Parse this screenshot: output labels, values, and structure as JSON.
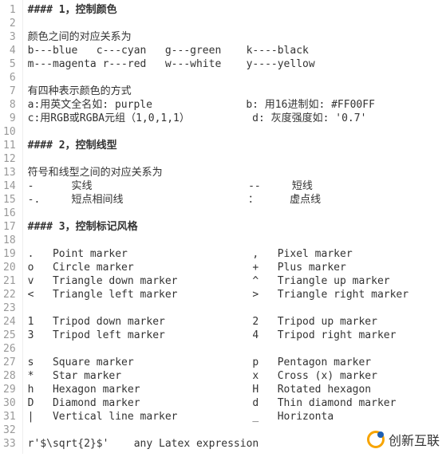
{
  "lines": [
    {
      "n": 1,
      "t": "#### 1，控制颜色",
      "c": "heading"
    },
    {
      "n": 2,
      "t": " "
    },
    {
      "n": 3,
      "t": "颜色之间的对应关系为"
    },
    {
      "n": 4,
      "t": "b---blue   c---cyan   g---green    k----black"
    },
    {
      "n": 5,
      "t": "m---magenta r---red   w---white    y----yellow"
    },
    {
      "n": 6,
      "t": " "
    },
    {
      "n": 7,
      "t": "有四种表示颜色的方式"
    },
    {
      "n": 8,
      "t": "a:用英文全名如: purple               b: 用16进制如: #FF00FF"
    },
    {
      "n": 9,
      "t": "c:用RGB或RGBA元组（1,0,1,1）          d: 灰度强度如: '0.7'"
    },
    {
      "n": 10,
      "t": " "
    },
    {
      "n": 11,
      "t": "#### 2，控制线型",
      "c": "heading"
    },
    {
      "n": 12,
      "t": " "
    },
    {
      "n": 13,
      "t": "符号和线型之间的对应关系为"
    },
    {
      "n": 14,
      "t": "-      实线                         --     短线"
    },
    {
      "n": 15,
      "t": "-.     短点相间线                    ：     虚点线"
    },
    {
      "n": 16,
      "t": " "
    },
    {
      "n": 17,
      "t": "#### 3，控制标记风格",
      "c": "heading"
    },
    {
      "n": 18,
      "t": " "
    },
    {
      "n": 19,
      "t": ".   Point marker                    ,   Pixel marker"
    },
    {
      "n": 20,
      "t": "o   Circle marker                   +   Plus marker"
    },
    {
      "n": 21,
      "t": "v   Triangle down marker            ^   Triangle up marker"
    },
    {
      "n": 22,
      "t": "<   Triangle left marker            >   Triangle right marker"
    },
    {
      "n": 23,
      "t": " "
    },
    {
      "n": 24,
      "t": "1   Tripod down marker              2   Tripod up marker"
    },
    {
      "n": 25,
      "t": "3   Tripod left marker              4   Tripod right marker"
    },
    {
      "n": 26,
      "t": " "
    },
    {
      "n": 27,
      "t": "s   Square marker                   p   Pentagon marker"
    },
    {
      "n": 28,
      "t": "*   Star marker                     x   Cross (x) marker"
    },
    {
      "n": 29,
      "t": "h   Hexagon marker                  H   Rotated hexagon"
    },
    {
      "n": 30,
      "t": "D   Diamond marker                  d   Thin diamond marker"
    },
    {
      "n": 31,
      "t": "|   Vertical line marker            _   Horizonta"
    },
    {
      "n": 32,
      "t": " "
    },
    {
      "n": 33,
      "t": "r'$\\sqrt{2}$'    any Latex expression"
    }
  ],
  "watermark": "创新互联"
}
